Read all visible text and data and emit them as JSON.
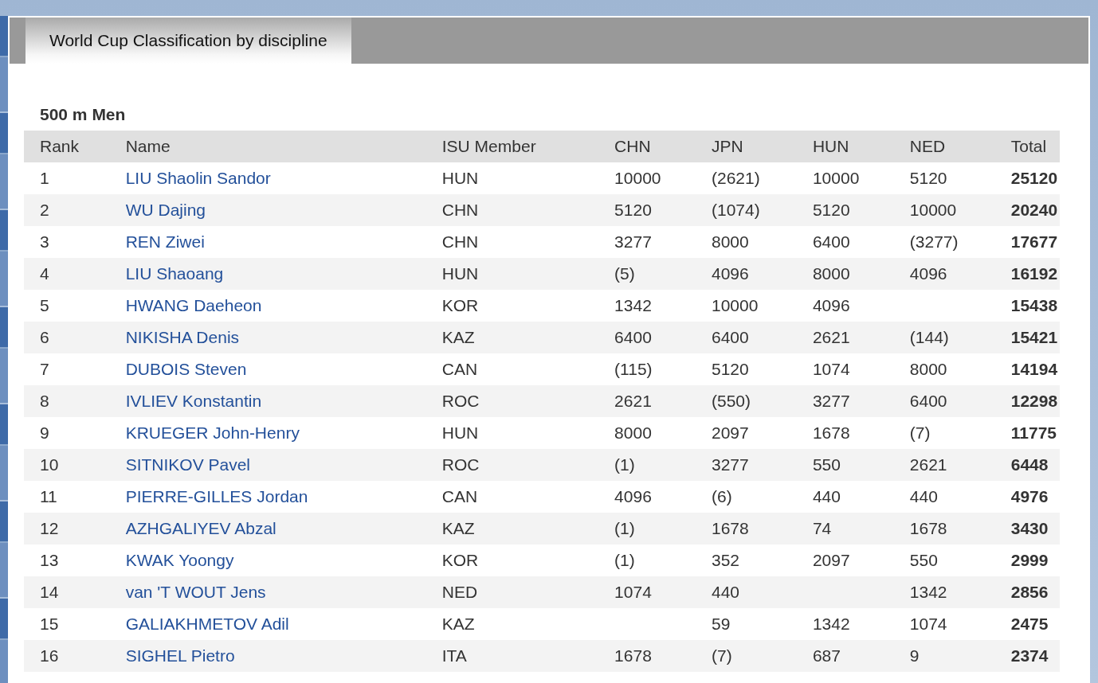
{
  "tab": {
    "label": "World Cup Classification by discipline",
    "selected": true
  },
  "section_title": "500 m Men",
  "table": {
    "columns": [
      "Rank",
      "Name",
      "ISU Member",
      "CHN",
      "JPN",
      "HUN",
      "NED",
      "Total"
    ],
    "rows": [
      {
        "rank": "1",
        "name": "LIU Shaolin Sandor",
        "member": "HUN",
        "chn": "10000",
        "jpn": "(2621)",
        "hun": "10000",
        "ned": "5120",
        "total": "25120"
      },
      {
        "rank": "2",
        "name": "WU Dajing",
        "member": "CHN",
        "chn": "5120",
        "jpn": "(1074)",
        "hun": "5120",
        "ned": "10000",
        "total": "20240"
      },
      {
        "rank": "3",
        "name": "REN Ziwei",
        "member": "CHN",
        "chn": "3277",
        "jpn": "8000",
        "hun": "6400",
        "ned": "(3277)",
        "total": "17677"
      },
      {
        "rank": "4",
        "name": "LIU Shaoang",
        "member": "HUN",
        "chn": "(5)",
        "jpn": "4096",
        "hun": "8000",
        "ned": "4096",
        "total": "16192"
      },
      {
        "rank": "5",
        "name": "HWANG Daeheon",
        "member": "KOR",
        "chn": "1342",
        "jpn": "10000",
        "hun": "4096",
        "total": "15438"
      },
      {
        "rank": "6",
        "name": "NIKISHA Denis",
        "member": "KAZ",
        "chn": "6400",
        "jpn": "6400",
        "hun": "2621",
        "ned": "(144)",
        "total": "15421"
      },
      {
        "rank": "7",
        "name": "DUBOIS Steven",
        "member": "CAN",
        "chn": "(115)",
        "jpn": "5120",
        "hun": "1074",
        "ned": "8000",
        "total": "14194"
      },
      {
        "rank": "8",
        "name": "IVLIEV Konstantin",
        "member": "ROC",
        "chn": "2621",
        "jpn": "(550)",
        "hun": "3277",
        "ned": "6400",
        "total": "12298"
      },
      {
        "rank": "9",
        "name": "KRUEGER John-Henry",
        "member": "HUN",
        "chn": "8000",
        "jpn": "2097",
        "hun": "1678",
        "ned": "(7)",
        "total": "11775"
      },
      {
        "rank": "10",
        "name": "SITNIKOV Pavel",
        "member": "ROC",
        "chn": "(1)",
        "jpn": "3277",
        "hun": "550",
        "ned": "2621",
        "total": "6448"
      },
      {
        "rank": "11",
        "name": "PIERRE-GILLES Jordan",
        "member": "CAN",
        "chn": "4096",
        "jpn": "(6)",
        "hun": "440",
        "ned": "440",
        "total": "4976"
      },
      {
        "rank": "12",
        "name": "AZHGALIYEV Abzal",
        "member": "KAZ",
        "chn": "(1)",
        "jpn": "1678",
        "hun": "74",
        "ned": "1678",
        "total": "3430"
      },
      {
        "rank": "13",
        "name": "KWAK Yoongy",
        "member": "KOR",
        "chn": "(1)",
        "jpn": "352",
        "hun": "2097",
        "ned": "550",
        "total": "2999"
      },
      {
        "rank": "14",
        "name": "van 'T WOUT Jens",
        "member": "NED",
        "chn": "1074",
        "jpn": "440",
        "ned": "1342",
        "total": "2856"
      },
      {
        "rank": "15",
        "name": "GALIAKHMETOV Adil",
        "member": "KAZ",
        "jpn": "59",
        "hun": "1342",
        "ned": "1074",
        "total": "2475"
      },
      {
        "rank": "16",
        "name": "SIGHEL Pietro",
        "member": "ITA",
        "chn": "1678",
        "jpn": "(7)",
        "hun": "687",
        "ned": "9",
        "total": "2374"
      }
    ]
  }
}
